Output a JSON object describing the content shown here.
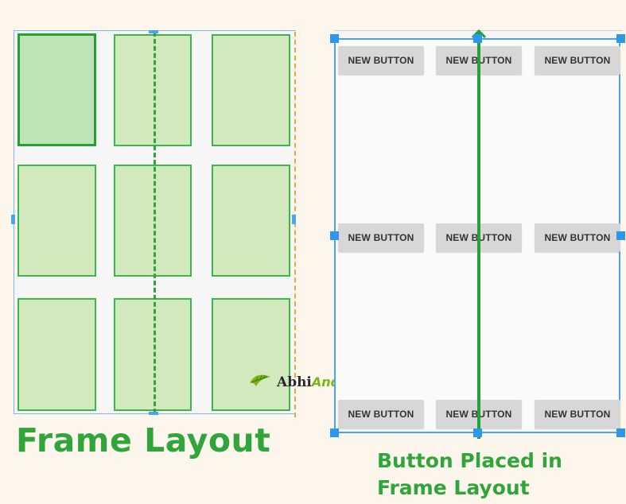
{
  "left_panel": {
    "caption": "Frame Layout"
  },
  "right_panel": {
    "button_label": "NEW BUTTON",
    "rows": [
      [
        "NEW BUTTON",
        "NEW BUTTON",
        "NEW BUTTON"
      ],
      [
        "NEW BUTTON",
        "NEW BUTTON",
        "NEW BUTTON"
      ],
      [
        "NEW BUTTON",
        "NEW BUTTON",
        "NEW BUTTON"
      ]
    ],
    "caption_line1": "Button Placed in",
    "caption_line2": "Frame Layout"
  },
  "logo": {
    "part1": "Abhi",
    "part2": "Android"
  },
  "colors": {
    "accent_green": "#2fa53a",
    "cell_fill": "#d2e8bd",
    "guide_orange": "#f2a533",
    "selection_blue": "#2f96ee"
  }
}
